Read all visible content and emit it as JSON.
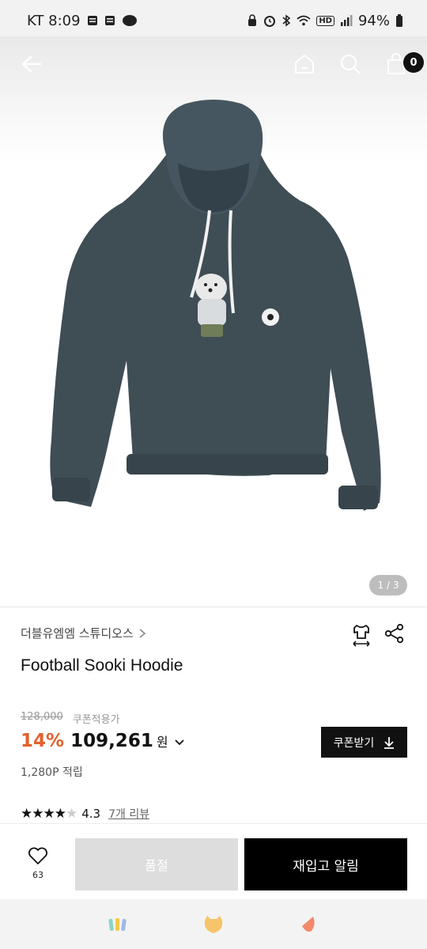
{
  "status_bar": {
    "carrier_time": "KT 8:09",
    "hd_label": "HD",
    "battery": "94%"
  },
  "image_pager": {
    "current_total": "1 / 3"
  },
  "cart": {
    "count": "0"
  },
  "product": {
    "brand": "더블유엠엠 스튜디오스",
    "title": "Football Sooki Hoodie",
    "original_price": "128,000",
    "coupon_note": "쿠폰적용가",
    "discount": "14%",
    "price": "109,261",
    "currency": "원",
    "coupon_button": "쿠폰받기",
    "points": "1,280P 적립",
    "rating": "4.3",
    "review_link": "7개 리뷰"
  },
  "purchase_bar": {
    "like_count": "63",
    "soldout_label": "품절",
    "restock_label": "재입고 알림"
  },
  "colors": {
    "accent_discount": "#e2612d",
    "primary_button": "#000000",
    "disabled_button": "#dddddd"
  },
  "icons": [
    "back-arrow-icon",
    "home-icon",
    "search-icon",
    "shopping-bag-icon",
    "size-guide-icon",
    "share-icon",
    "heart-icon",
    "download-icon",
    "app-nav-icon-1",
    "app-nav-icon-2",
    "app-nav-icon-3"
  ]
}
